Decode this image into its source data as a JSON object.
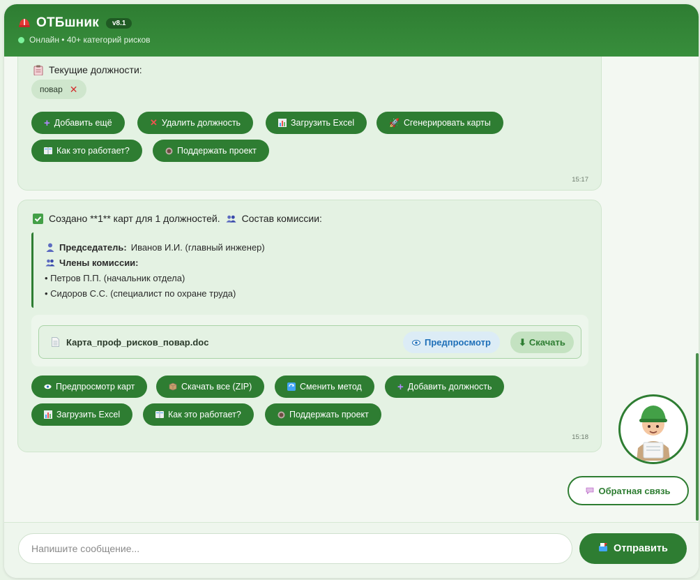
{
  "header": {
    "title": "ОТБшник",
    "version": "v8.1",
    "status": "Онлайн • 40+ категорий рисков",
    "accent": "#2e7d32"
  },
  "msg1": {
    "heading": "Текущие должности:",
    "tag": "повар",
    "buttons": [
      {
        "icon": "plus-icon",
        "label": "Добавить ещё"
      },
      {
        "icon": "cross-icon",
        "label": "Удалить должность"
      },
      {
        "icon": "chart-icon",
        "label": "Загрузить Excel"
      },
      {
        "icon": "rocket-icon",
        "label": "Сгенерировать карты"
      },
      {
        "icon": "book-icon",
        "label": "Как это работает?"
      },
      {
        "icon": "coffee-icon",
        "label": "Поддержать проект"
      }
    ],
    "time": "15:17"
  },
  "msg2": {
    "heading_a": "Создано **1** карт для 1 должностей.",
    "heading_b": "Состав комиссии:",
    "chairman_label": "Председатель:",
    "chairman": "Иванов И.И. (главный инженер)",
    "members_label": "Члены комиссии:",
    "members": [
      "• Петров П.П. (начальник отдела)",
      "• Сидоров С.С. (специалист по охране труда)"
    ],
    "file_name": "Карта_проф_рисков_повар.doc",
    "preview_label": "Предпросмотр",
    "download_label": "Скачать",
    "buttons": [
      {
        "icon": "eye-icon",
        "label": "Предпросмотр карт"
      },
      {
        "icon": "package-icon",
        "label": "Скачать все (ZIP)"
      },
      {
        "icon": "refresh-icon",
        "label": "Сменить метод"
      },
      {
        "icon": "plus-icon",
        "label": "Добавить должность"
      },
      {
        "icon": "chart-icon",
        "label": "Загрузить Excel"
      },
      {
        "icon": "book-icon",
        "label": "Как это работает?"
      },
      {
        "icon": "coffee-icon",
        "label": "Поддержать проект"
      }
    ],
    "time": "15:18"
  },
  "feedback_label": "Обратная связь",
  "composer": {
    "placeholder": "Напишите сообщение...",
    "send_label": "Отправить"
  }
}
